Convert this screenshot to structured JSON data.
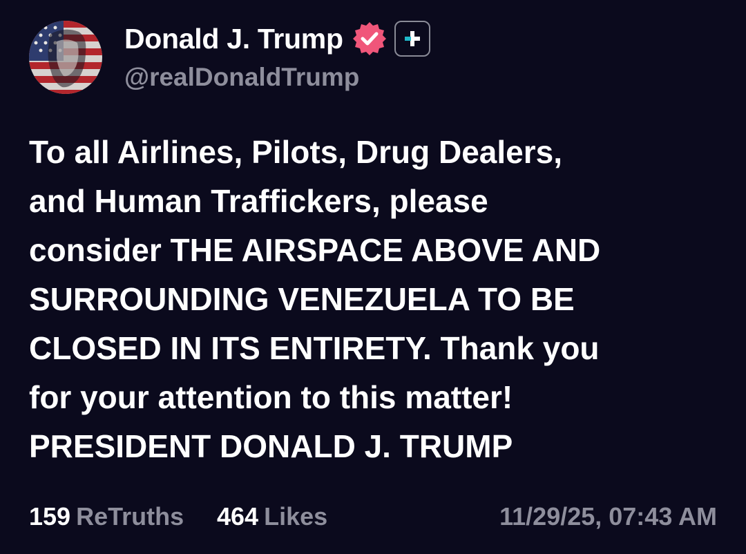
{
  "author": {
    "display_name": "Donald J. Trump",
    "handle": "@realDonaldTrump",
    "avatar_icon": "american-flag-portrait",
    "verified_icon": "verified-badge-icon",
    "follow_icon": "plus-icon"
  },
  "post": {
    "lines": [
      "To all Airlines, Pilots, Drug Dealers,",
      "and Human Traffickers, please",
      "consider THE AIRSPACE ABOVE AND",
      "SURROUNDING VENEZUELA TO BE",
      "CLOSED IN ITS ENTIRETY. Thank you",
      "for your attention to this matter!",
      "PRESIDENT DONALD J. TRUMP"
    ]
  },
  "stats": {
    "retruths_count": "159",
    "retruths_label": "ReTruths",
    "likes_count": "464",
    "likes_label": "Likes",
    "timestamp": "11/29/25, 07:43 AM"
  },
  "colors": {
    "background": "#0b0a1d",
    "text_primary": "#ffffff",
    "text_secondary": "#8e8e9c",
    "verified_pink": "#f0567a"
  }
}
